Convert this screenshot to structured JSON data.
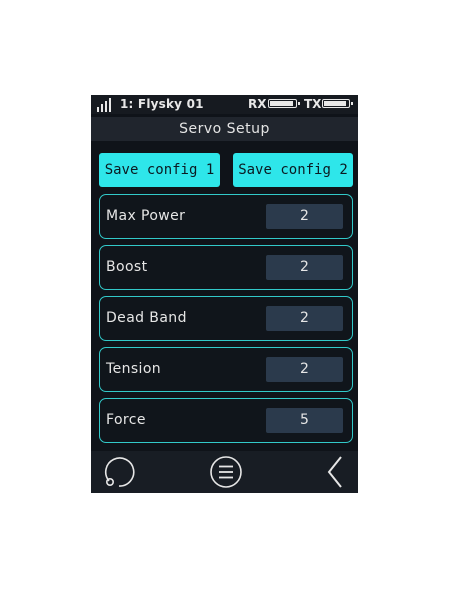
{
  "status_bar": {
    "model": "1: Flysky  01",
    "rx_label": "RX",
    "tx_label": "TX",
    "signal_icon": "signal-bars-icon",
    "battery_icon": "battery-icon"
  },
  "title": "Servo Setup",
  "buttons": {
    "save_config_1": "Save config 1",
    "save_config_2": "Save config 2"
  },
  "params": [
    {
      "label": "Max Power",
      "value": "2"
    },
    {
      "label": "Boost",
      "value": "2"
    },
    {
      "label": "Dead Band",
      "value": "2"
    },
    {
      "label": "Tension",
      "value": "2"
    },
    {
      "label": "Force",
      "value": "5"
    }
  ],
  "nav": {
    "left_icon": "rotate-icon",
    "center_icon": "menu-icon",
    "right_icon": "back-chevron-icon"
  },
  "colors": {
    "accent": "#2ee6ea",
    "row_border": "#32c9c9",
    "value_box": "#2b3a4c",
    "background": "#0f1319"
  }
}
